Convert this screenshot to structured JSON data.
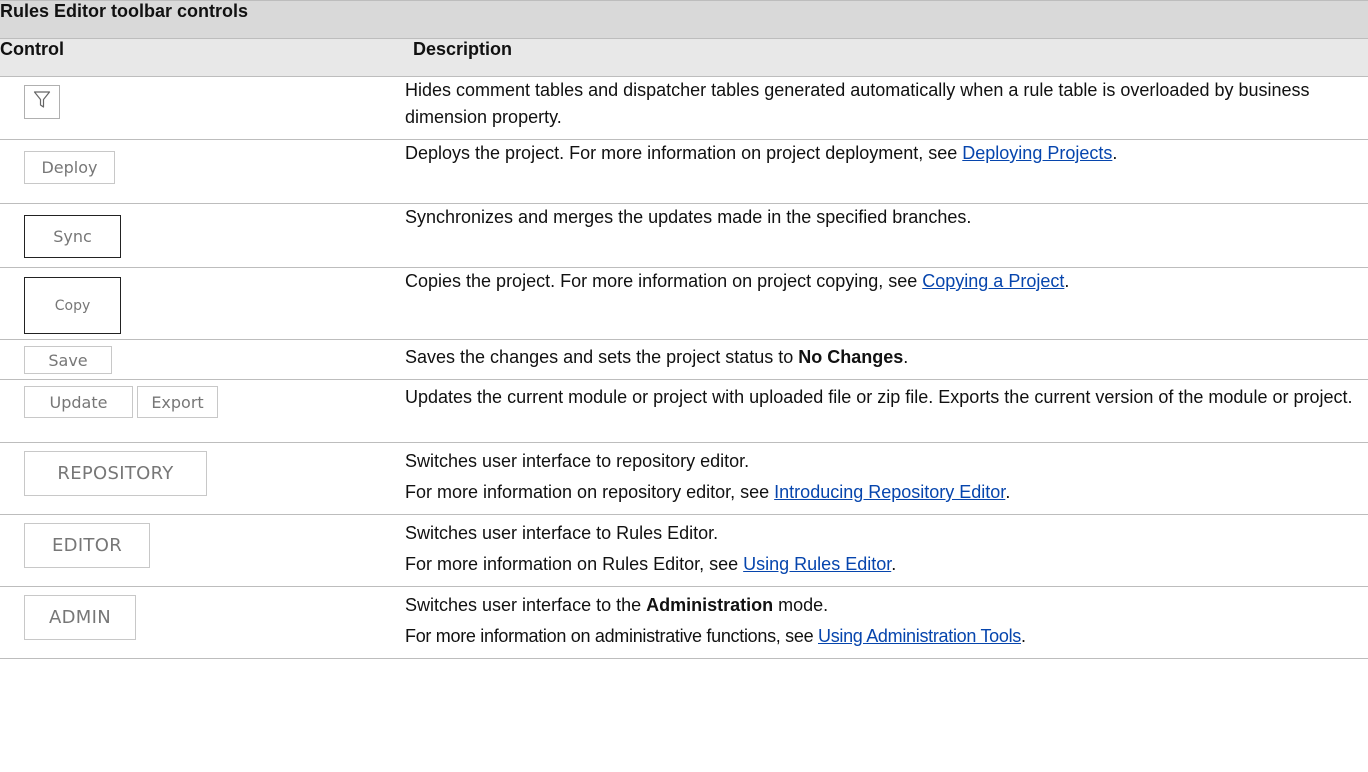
{
  "table_title": "Rules Editor toolbar controls",
  "headers": {
    "control": "Control",
    "description": "Description"
  },
  "rows": [
    {
      "control": {
        "icon": "filter-icon"
      },
      "desc": "Hides comment tables and dispatcher tables generated automatically when a rule table is overloaded by business dimension property."
    },
    {
      "control": {
        "label": "Deploy"
      },
      "desc_pre": "Deploys the project. For more information on project deployment, see ",
      "link": "Deploying Projects",
      "desc_post": "."
    },
    {
      "control": {
        "label": "Sync"
      },
      "desc": "Synchronizes and merges the updates made in the specified branches."
    },
    {
      "control": {
        "label": "Copy"
      },
      "desc_pre": "Copies the project. For more information on project copying, see ",
      "link": "Copying a Project",
      "desc_post": "."
    },
    {
      "control": {
        "label": "Save"
      },
      "desc_pre": "Saves the changes and sets the project status to ",
      "bold": "No Changes",
      "desc_post": "."
    },
    {
      "control": {
        "label": "Update",
        "label2": "Export"
      },
      "desc": "Updates the current module or project with uploaded file or zip file. Exports the current version of the module or project."
    },
    {
      "control": {
        "label": "REPOSITORY"
      },
      "desc": "Switches user interface to repository editor.",
      "desc2_pre": "For more information on repository editor, see ",
      "link": "Introducing Repository Editor",
      "desc2_post": "."
    },
    {
      "control": {
        "label": "EDITOR"
      },
      "desc": "Switches user interface to Rules Editor.",
      "desc2_pre": "For more information on Rules Editor, see ",
      "link": "Using Rules Editor",
      "desc2_post": "."
    },
    {
      "control": {
        "label": "ADMIN"
      },
      "desc_pre": "Switches user interface to the ",
      "bold": "Administration",
      "desc_post": " mode.",
      "desc2_pre": "For more information on administrative functions, see ",
      "link": "Using Administration Tools",
      "desc2_post": "."
    }
  ]
}
